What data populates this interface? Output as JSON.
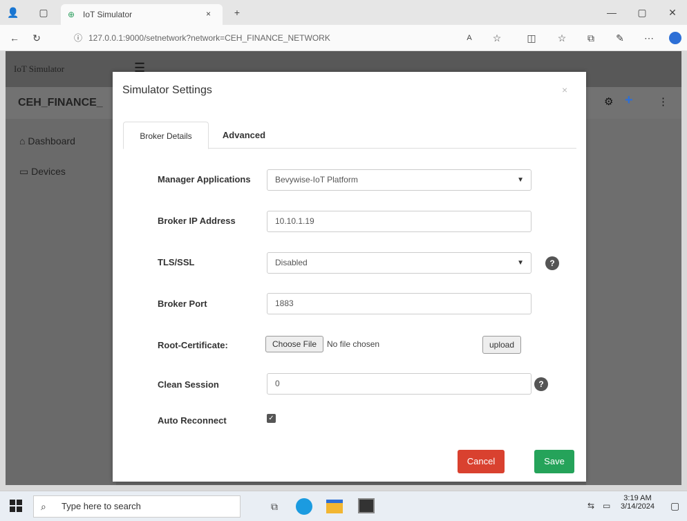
{
  "browser": {
    "tab_title": "IoT Simulator",
    "new_tab": "+",
    "url": "127.0.0.1:9000/setnetwork?network=CEH_FINANCE_NETWORK",
    "window_controls": [
      "—",
      "▢",
      "✕"
    ]
  },
  "app": {
    "brand": "IoT Simulator",
    "network_title": "CEH_FINANCE_",
    "sidebar": [
      {
        "label": "Dashboard",
        "icon": "dashboard-icon"
      },
      {
        "label": "Devices",
        "icon": "monitor-icon"
      }
    ]
  },
  "modal": {
    "title": "Simulator Settings",
    "close": "×",
    "tabs": [
      "Broker Details",
      "Advanced"
    ],
    "fields": {
      "manager_applications": {
        "label": "Manager Applications",
        "value": "Bevywise-IoT Platform"
      },
      "broker_ip": {
        "label": "Broker IP Address",
        "value": "10.10.1.19"
      },
      "tls_ssl": {
        "label": "TLS/SSL",
        "value": "Disabled"
      },
      "broker_port": {
        "label": "Broker Port",
        "value": "1883"
      },
      "root_certificate": {
        "label": "Root-Certificate:",
        "choose": "Choose File",
        "status": "No file chosen",
        "upload": "upload"
      },
      "clean_session": {
        "label": "Clean Session",
        "value": "0"
      },
      "auto_reconnect": {
        "label": "Auto Reconnect",
        "checked": true
      }
    },
    "help": "?",
    "cancel": "Cancel",
    "save": "Save"
  },
  "taskbar": {
    "search_placeholder": "Type here to search",
    "time": "3:19 AM",
    "date": "3/14/2024"
  },
  "colors": {
    "cancel": "#d9412f",
    "save": "#25a35a",
    "accent": "#2d6fd6"
  }
}
